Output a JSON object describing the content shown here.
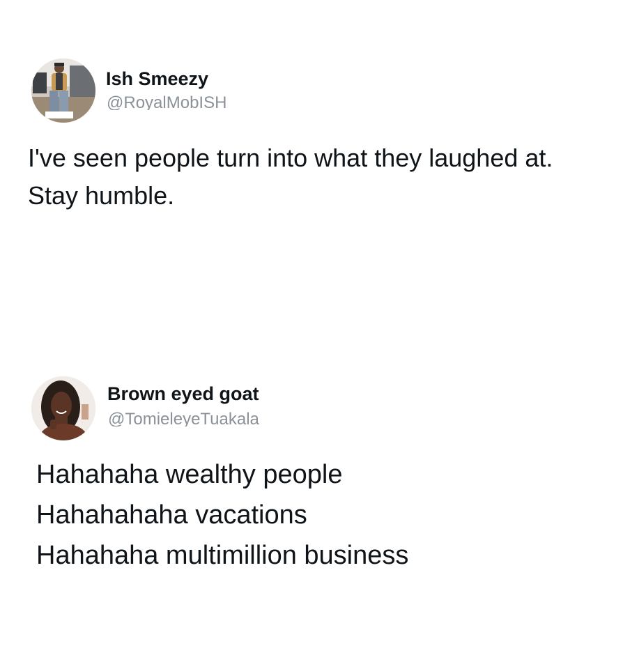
{
  "tweets": [
    {
      "display_name": "Ish Smeezy",
      "handle": "@RoyalMobISH",
      "handle_redacted": true,
      "text_lines": [
        "I've seen people turn into what they laughed at.",
        "Stay humble."
      ]
    },
    {
      "display_name": "Brown eyed goat",
      "handle": "@TomieleyeTuakala",
      "handle_redacted": true,
      "text_lines": [
        "Hahahaha wealthy people",
        "Hahahahaha vacations",
        "Hahahaha multimillion business"
      ]
    }
  ],
  "colors": {
    "text": "#0f1419",
    "handle": "#8a9198",
    "redaction_start": "#f07a45",
    "redaction_end": "#2a163c"
  }
}
